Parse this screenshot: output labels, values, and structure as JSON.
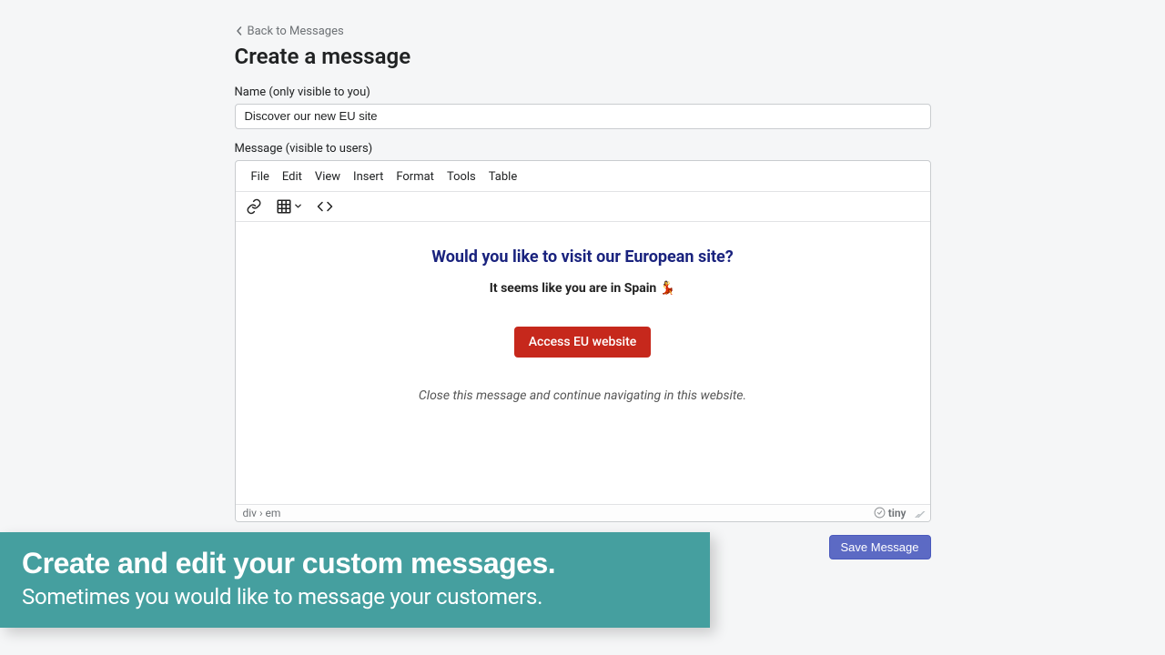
{
  "back_link": "Back to Messages",
  "page_title": "Create a message",
  "name_field": {
    "label": "Name (only visible to you)",
    "value": "Discover our new EU site"
  },
  "message_field": {
    "label": "Message (visible to users)"
  },
  "editor": {
    "menu": [
      "File",
      "Edit",
      "View",
      "Insert",
      "Format",
      "Tools",
      "Table"
    ],
    "statusbar_path": "div › em",
    "brand": "tiny"
  },
  "content": {
    "headline": "Would you like to visit our European site?",
    "subline": "It seems like you are in Spain 💃",
    "button": "Access EU website",
    "note": "Close this message and continue navigating in this website."
  },
  "save_button": "Save Message",
  "promo": {
    "headline": "Create and edit your custom messages.",
    "sub": "Sometimes you would like to message your customers."
  }
}
